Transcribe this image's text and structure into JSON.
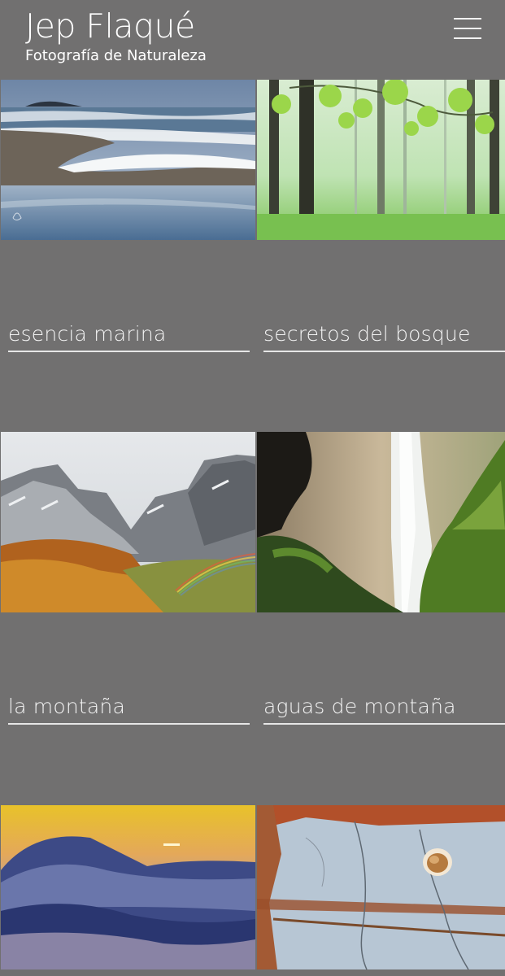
{
  "header": {
    "title": "Jep Flaqué",
    "subtitle": "Fotografía de Naturaleza",
    "menu_icon": "hamburger-menu-icon"
  },
  "gallery": [
    {
      "label": "esencia marina",
      "image": "seascape-beach-photo"
    },
    {
      "label": "secretos del bosque",
      "image": "misty-forest-photo"
    },
    {
      "label": "la montaña",
      "image": "mountain-rainbow-photo"
    },
    {
      "label": "aguas de montaña",
      "image": "waterfall-photo"
    },
    {
      "label": "",
      "image": "sea-of-clouds-sunset-photo"
    },
    {
      "label": "",
      "image": "rock-with-shell-photo"
    }
  ],
  "colors": {
    "background": "#717070",
    "text": "#ffffff",
    "underline": "#e6e6e6"
  }
}
